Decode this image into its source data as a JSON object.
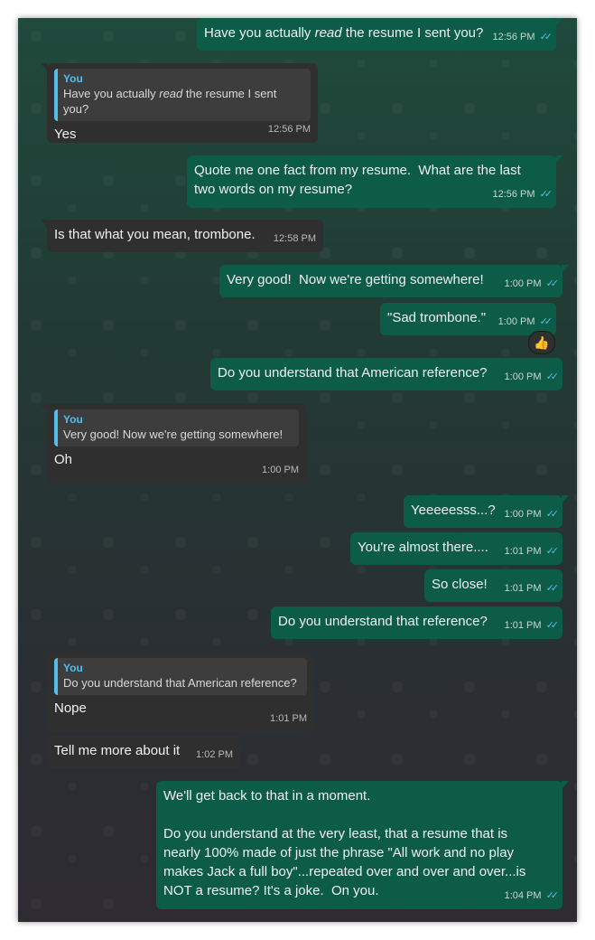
{
  "messages": [
    {
      "dir": "out",
      "text_before": "Have you actually ",
      "text_em": "read",
      "text_after": " the resume I sent you?",
      "time": "12:56 PM"
    },
    {
      "dir": "in",
      "quote_author": "You",
      "quote_before": "Have you actually ",
      "quote_em": "read",
      "quote_after": " the resume I sent you?",
      "text": "Yes",
      "time": "12:56 PM"
    },
    {
      "dir": "out",
      "text": "Quote me one fact from my resume.  What are the last two words on my resume?",
      "time": "12:56 PM"
    },
    {
      "dir": "in",
      "text": "Is that what you mean, trombone.",
      "time": "12:58 PM"
    },
    {
      "dir": "out",
      "text": "Very good!  Now we're getting somewhere!",
      "time": "1:00 PM"
    },
    {
      "dir": "out",
      "text": "\"Sad trombone.\"",
      "time": "1:00 PM",
      "reaction": "👍"
    },
    {
      "dir": "out",
      "text": "Do you understand that American reference?",
      "time": "1:00 PM"
    },
    {
      "dir": "in",
      "quote_author": "You",
      "quote_text": "Very good!  Now we're getting somewhere!",
      "text": "Oh",
      "time": "1:00 PM"
    },
    {
      "dir": "out",
      "text": "Yeeeeesss...?",
      "time": "1:00 PM"
    },
    {
      "dir": "out",
      "text": "You're almost there....",
      "time": "1:01 PM"
    },
    {
      "dir": "out",
      "text": "So close!",
      "time": "1:01 PM"
    },
    {
      "dir": "out",
      "text": "Do you understand that reference?",
      "time": "1:01 PM"
    },
    {
      "dir": "in",
      "quote_author": "You",
      "quote_text": "Do you understand that American reference?",
      "text": "Nope",
      "time": "1:01 PM"
    },
    {
      "dir": "in",
      "text": "Tell me more about it",
      "time": "1:02 PM"
    },
    {
      "dir": "out",
      "text": "We'll get back to that in a moment.\n\nDo you understand at the very least, that a resume that is nearly 100% made of just the phrase \"All work and no play makes Jack a full boy\"...repeated over and over and over...is NOT a resume? It's a joke.  On you.",
      "time": "1:04 PM"
    }
  ],
  "icons": {
    "read_ticks": "double-check-icon",
    "read_color": "#53bdeb"
  },
  "colors": {
    "outgoing": "#0d5c47",
    "incoming": "#2f2f2f",
    "quote_bar": "#53bdeb"
  }
}
